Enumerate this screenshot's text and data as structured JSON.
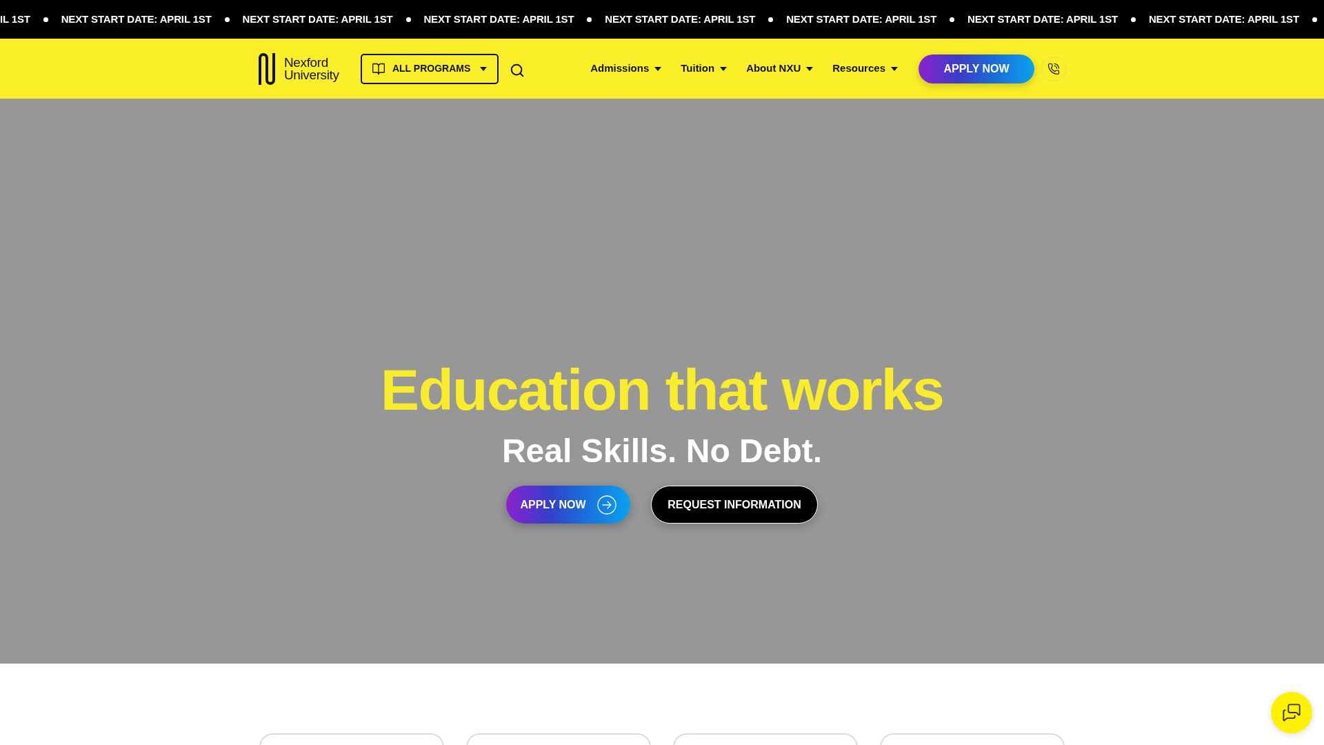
{
  "ticker": {
    "items": [
      "IL 1ST",
      "NEXT START DATE: APRIL 1ST",
      "NEXT START DATE: APRIL 1ST",
      "NEXT START DATE: APRIL 1ST",
      "NEXT START DATE: APRIL 1ST",
      "NEXT START DATE: APRIL 1ST",
      "NEXT START DATE: APRIL 1ST",
      "NEXT START DATE: APRIL 1ST"
    ]
  },
  "header": {
    "logo": {
      "line1": "Nexford",
      "line2": "University"
    },
    "programs_button": {
      "label": "ALL PROGRAMS"
    },
    "nav": [
      {
        "label": "Admissions"
      },
      {
        "label": "Tuition"
      },
      {
        "label": "About NXU"
      },
      {
        "label": "Resources"
      }
    ],
    "apply_button": {
      "label": "APPLY NOW"
    }
  },
  "hero": {
    "title": "Education that works",
    "subtitle": "Real Skills. No Debt.",
    "buttons": [
      {
        "label": "APPLY NOW",
        "kind": "primary"
      },
      {
        "label": "REQUEST INFORMATION",
        "kind": "outline"
      }
    ]
  }
}
